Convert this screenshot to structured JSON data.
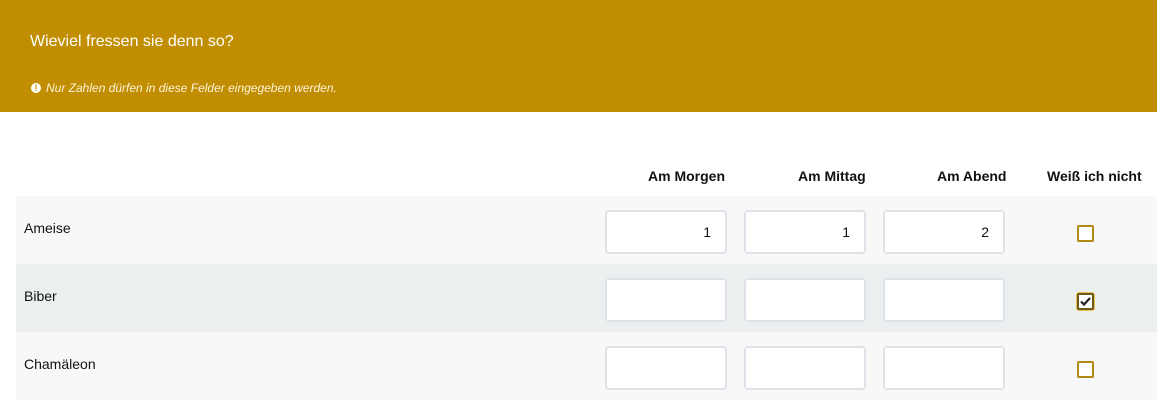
{
  "question": {
    "title": "Wieviel fressen sie denn so?",
    "hint": "Nur Zahlen dürfen in diese Felder eingegeben werden.",
    "hint_icon": "exclamation-circle-icon"
  },
  "columns": [
    "Am Morgen",
    "Am Mittag",
    "Am Abend",
    "Weiß ich nicht"
  ],
  "rows": [
    {
      "label": "Ameise",
      "values": [
        "1",
        "1",
        "2"
      ],
      "dont_know": false
    },
    {
      "label": "Biber",
      "values": [
        "",
        "",
        ""
      ],
      "dont_know": true
    },
    {
      "label": "Chamäleon",
      "values": [
        "",
        "",
        ""
      ],
      "dont_know": false
    }
  ],
  "colors": {
    "header_background": "#c08e00",
    "checkbox_border": "#b58a14"
  }
}
